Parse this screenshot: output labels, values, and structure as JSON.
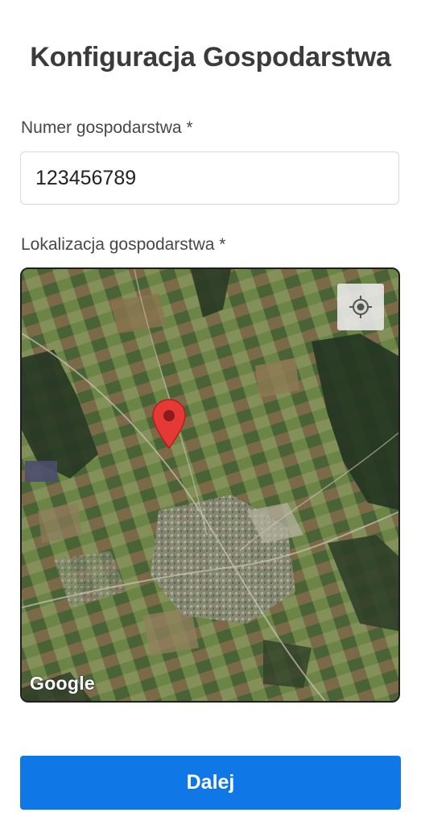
{
  "page": {
    "title": "Konfiguracja Gospodarstwa"
  },
  "form": {
    "farm_number_label": "Numer gospodarstwa *",
    "farm_number_value": "123456789",
    "location_label": "Lokalizacja gospodarstwa *"
  },
  "map": {
    "view": "satellite",
    "attribution": "Google",
    "locate_button_icon": "crosshair-location-icon",
    "marker_icon": "map-pin-icon",
    "marker_color": "#e53935"
  },
  "actions": {
    "next_label": "Dalej",
    "next_color": "#0f78e6"
  }
}
